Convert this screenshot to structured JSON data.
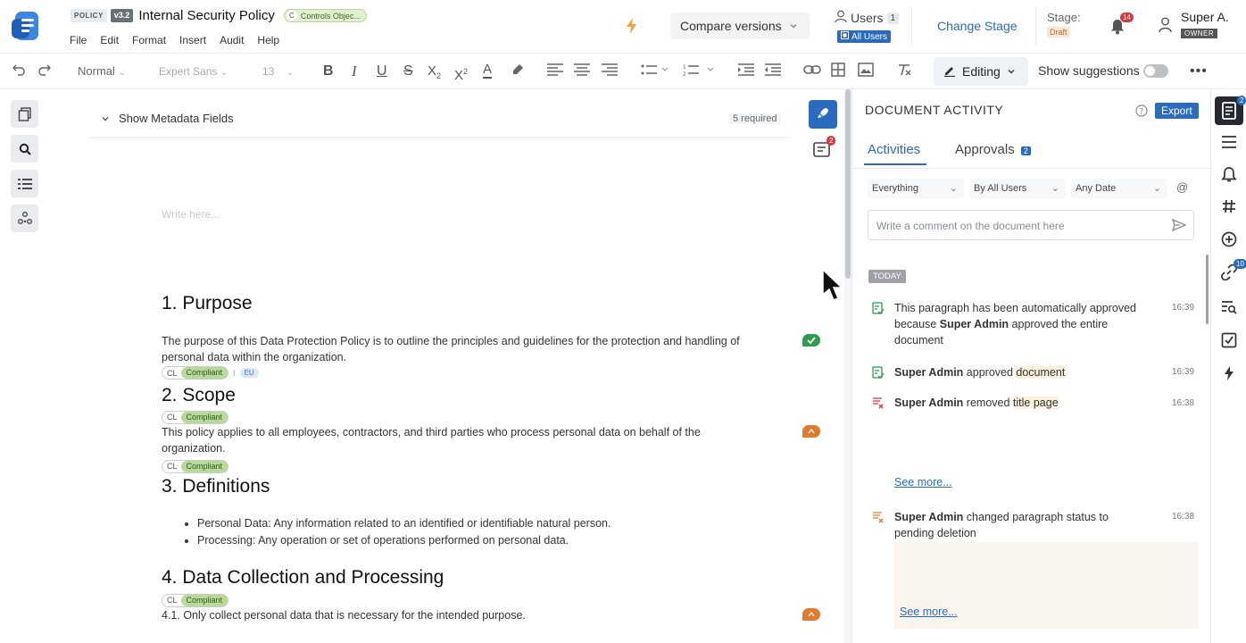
{
  "header": {
    "doc_type": "POLICY",
    "version": "v3.2",
    "title": "Internal Security Policy",
    "category_letter": "C",
    "category": "Controls Objec...",
    "menu": [
      "File",
      "Edit",
      "Format",
      "Insert",
      "Audit",
      "Help"
    ],
    "compare_label": "Compare versions",
    "users_label": "Users",
    "users_count": "1",
    "all_users_label": "All Users",
    "change_stage_label": "Change Stage",
    "stage_label": "Stage:",
    "stage_value": "Draft",
    "notifications_count": "14",
    "user_name": "Super A.",
    "user_role": "OWNER"
  },
  "toolbar": {
    "style": "Normal",
    "font": "Expert Sans",
    "size": "13",
    "editing_label": "Editing",
    "suggestions_label": "Show suggestions"
  },
  "editor": {
    "metadata_label": "Show Metadata Fields",
    "required_label": "5 required",
    "comments_count": "2",
    "placeholder": "Write here...",
    "chip_cl": "CL",
    "chip_status": "Compliant",
    "chip_eu": "EU",
    "chip_sep": "I",
    "sections": [
      {
        "heading": "1. Purpose",
        "text": "The purpose of this Data Protection Policy is to outline the principles and guidelines for the protection and handling of personal data within the organization."
      },
      {
        "heading": "2. Scope",
        "text": "This policy applies to all employees, contractors, and third parties who process personal data on behalf of the organization."
      },
      {
        "heading": "3. Definitions",
        "bullets": [
          "Personal Data: Any information related to an identified or identifiable natural person.",
          "Processing: Any operation or set of operations performed on personal data."
        ]
      },
      {
        "heading": "4. Data Collection and Processing",
        "text": "4.1. Only collect personal data that is necessary for the intended purpose."
      }
    ]
  },
  "panel": {
    "title": "DOCUMENT ACTIVITY",
    "export_label": "Export",
    "tabs": [
      "Activities",
      "Approvals"
    ],
    "approvals_count": "2",
    "filters": [
      "Everything",
      "By All Users",
      "Any Date"
    ],
    "comment_placeholder": "Write a comment on the document here",
    "today_label": "TODAY",
    "activities": [
      {
        "pre": "This paragraph has been automatically approved because ",
        "actor": "Super Admin",
        "post": " approved the entire document",
        "time": "16:39"
      },
      {
        "actor": "Super Admin",
        "action": " approved ",
        "target": "document",
        "time": "16:39"
      },
      {
        "actor": "Super Admin",
        "action": " removed ",
        "target": "title page",
        "time": "16:38"
      },
      {
        "actor": "Super Admin",
        "action": " changed paragraph status to pending deletion",
        "time": "16:38"
      }
    ],
    "see_more": "See more..."
  },
  "right_rail": {
    "doc_badge": "2",
    "link_badge": "10"
  },
  "colors": {
    "accent": "#2a6bbf",
    "compliant": "#b8d99a",
    "approved": "#2e9b4e",
    "pending": "#e07a2e"
  }
}
